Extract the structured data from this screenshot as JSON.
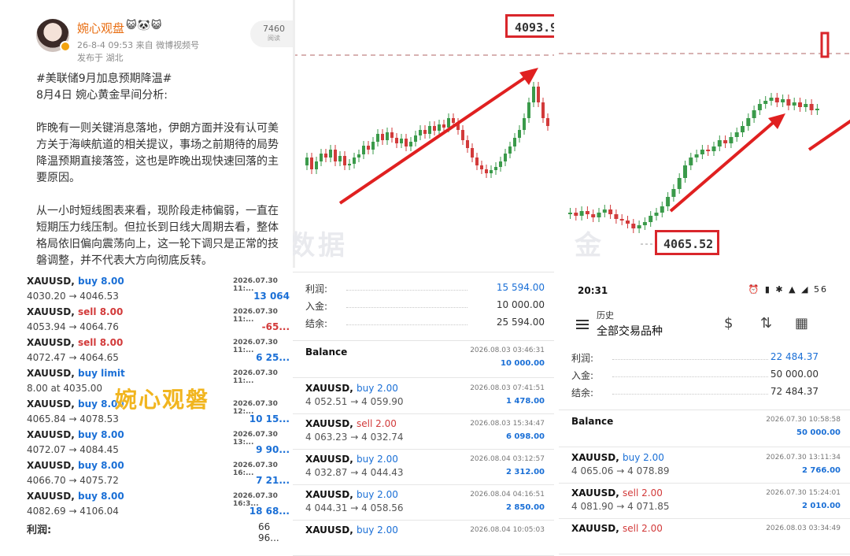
{
  "post": {
    "author": "婉心观盘",
    "emojis": "😺🐼😺",
    "meta": "26-8-4 09:53  来自 微博视频号",
    "location": "发布于 湖北",
    "read_count": "7460",
    "read_label": "阅读",
    "body": "#美联储9月加息预期降温#\n8月4日 婉心黄金早间分析:\n\n昨晚有一则关键消息落地，伊朗方面并没有认可美\n方关于海峡航道的相关提议，事场之前期待的局势\n降温预期直接落签，这也是昨晚出现快速回落的主\n要原因。\n\n从一小时短线图表来看，现阶段走柿偏弱，一直在\n短期压力线压制。但拉长到日线大周期去看，整体\n格局依旧偏向震荡向上，这一轮下调只是正常的技\n磐调整，并不代表大方向彻底反转。",
    "watermark": "婉心观磐"
  },
  "trades_left": [
    {
      "sym": "XAUUSD,",
      "dir": "buy 8.00",
      "side": "buy",
      "date": "2026.07.30 11:...",
      "prices": "4030.20 → 4046.53",
      "profit": "13 064"
    },
    {
      "sym": "XAUUSD,",
      "dir": "sell 8.00",
      "side": "sell",
      "date": "2026.07.30 11:...",
      "prices": "4053.94 → 4064.76",
      "profit": "-65..."
    },
    {
      "sym": "XAUUSD,",
      "dir": "sell 8.00",
      "side": "sell",
      "date": "2026.07.30 11:...",
      "prices": "4072.47 → 4064.65",
      "profit": "6 25..."
    },
    {
      "sym": "XAUUSD,",
      "dir": "buy limit",
      "side": "buy",
      "date": "2026.07.30 11:...",
      "prices": "8.00 at 4035.00",
      "profit": ""
    },
    {
      "sym": "XAUUSD,",
      "dir": "buy 8.00",
      "side": "buy",
      "date": "2026.07.30 12:...",
      "prices": "4065.84 → 4078.53",
      "profit": "10 15..."
    },
    {
      "sym": "XAUUSD,",
      "dir": "buy 8.00",
      "side": "buy",
      "date": "2026.07.30 13:...",
      "prices": "4072.07 → 4084.45",
      "profit": "9 90..."
    },
    {
      "sym": "XAUUSD,",
      "dir": "buy 8.00",
      "side": "buy",
      "date": "2026.07.30 16:...",
      "prices": "4066.70 → 4075.72",
      "profit": "7 21..."
    },
    {
      "sym": "XAUUSD,",
      "dir": "buy 8.00",
      "side": "buy",
      "date": "2026.07.30 16:3...",
      "prices": "4082.69 → 4106.04",
      "profit": "18 68..."
    }
  ],
  "left_total": {
    "label": "利润:",
    "value": "66 96..."
  },
  "chart2": {
    "price_tag": "4093.9",
    "watermark": "数据"
  },
  "chart3": {
    "price_tag": "4065.52",
    "watermark": "金"
  },
  "account2": {
    "rows": [
      {
        "label": "利润:",
        "value": "15 594.00",
        "accent": true
      },
      {
        "label": "入金:",
        "value": "10 000.00",
        "accent": false
      },
      {
        "label": "结余:",
        "value": "25 594.00",
        "accent": false
      }
    ],
    "balance": {
      "title": "Balance",
      "date": "2026.08.03 03:46:31",
      "amount": "10 000.00"
    },
    "deals": [
      {
        "sym": "XAUUSD,",
        "dir": "buy 2.00",
        "side": "buy",
        "date": "2026.08.03 07:41:51",
        "prices": "4 052.51 → 4 059.90",
        "profit": "1 478.00"
      },
      {
        "sym": "XAUUSD,",
        "dir": "sell 2.00",
        "side": "sell",
        "date": "2026.08.03 15:34:47",
        "prices": "4 063.23 → 4 032.74",
        "profit": "6 098.00"
      },
      {
        "sym": "XAUUSD,",
        "dir": "buy 2.00",
        "side": "buy",
        "date": "2026.08.04 03:12:57",
        "prices": "4 032.87 → 4 044.43",
        "profit": "2 312.00"
      },
      {
        "sym": "XAUUSD,",
        "dir": "buy 2.00",
        "side": "buy",
        "date": "2026.08.04 04:16:51",
        "prices": "4 044.31 → 4 058.56",
        "profit": "2 850.00"
      },
      {
        "sym": "XAUUSD,",
        "dir": "buy 2.00",
        "side": "buy",
        "date": "2026.08.04 10:05:03",
        "prices": "",
        "profit": ""
      }
    ]
  },
  "status": {
    "time": "20:31",
    "icons": "⏰ ▮ ✱ ▲ ◢ 56"
  },
  "header": {
    "subtitle": "历史",
    "title": "全部交易品种",
    "icon_currency": "$",
    "icon_sort": "⇅",
    "icon_calendar": "▦"
  },
  "account3": {
    "rows": [
      {
        "label": "利润:",
        "value": "22 484.37",
        "accent": true
      },
      {
        "label": "入金:",
        "value": "50 000.00",
        "accent": false
      },
      {
        "label": "结余:",
        "value": "72 484.37",
        "accent": false
      }
    ],
    "balance": {
      "title": "Balance",
      "date": "2026.07.30 10:58:58",
      "amount": "50 000.00"
    },
    "deals": [
      {
        "sym": "XAUUSD,",
        "dir": "buy 2.00",
        "side": "buy",
        "date": "2026.07.30 13:11:34",
        "prices": "4 065.06 → 4 078.89",
        "profit": "2 766.00"
      },
      {
        "sym": "XAUUSD,",
        "dir": "sell 2.00",
        "side": "sell",
        "date": "2026.07.30 15:24:01",
        "prices": "4 081.90 → 4 071.85",
        "profit": "2 010.00"
      },
      {
        "sym": "XAUUSD,",
        "dir": "sell 2.00",
        "side": "sell",
        "date": "2026.08.03 03:34:49",
        "prices": "",
        "profit": ""
      }
    ]
  },
  "colors": {
    "buy": "#1a6fd6",
    "sell": "#d23a3a",
    "candle_up": "#3a9a4a",
    "candle_down": "#d23a3a",
    "arrow": "#e02020"
  }
}
